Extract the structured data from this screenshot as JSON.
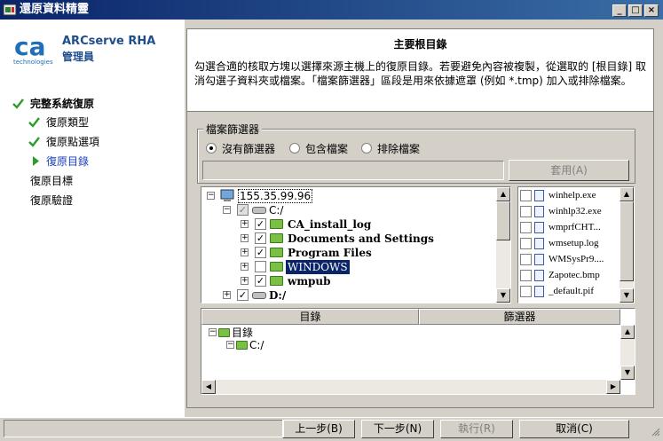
{
  "window": {
    "title": "還原資料精靈",
    "controls": [
      "_",
      "□",
      "×"
    ]
  },
  "brand": {
    "logo_text": "ca",
    "logo_sub": "technologies",
    "name": "ARCserve RHA",
    "subtitle": "管理員"
  },
  "nav": [
    {
      "label": "完整系統復原",
      "state": "done"
    },
    {
      "label": "復原類型",
      "state": "done"
    },
    {
      "label": "復原點選項",
      "state": "done"
    },
    {
      "label": "復原目錄",
      "state": "current"
    },
    {
      "label": "復原目標",
      "state": "todo"
    },
    {
      "label": "復原驗證",
      "state": "todo"
    }
  ],
  "header": {
    "title": "主要根目錄",
    "description": "勾選合適的核取方塊以選擇來源主機上的復原目錄。若要避免內容被複製，從選取的 [根目錄] 取消勾選子資料夾或檔案。「檔案篩選器」區段是用來依據遮罩 (例如 *.tmp) 加入或排除檔案。"
  },
  "filter": {
    "legend": "檔案篩選器",
    "options": [
      {
        "label": "沒有篩選器",
        "selected": true
      },
      {
        "label": "包含檔案",
        "selected": false
      },
      {
        "label": "排除檔案",
        "selected": false
      }
    ],
    "input_value": "",
    "apply_label": "套用(A)"
  },
  "tree": {
    "host": "155.35.99.96",
    "drive_c": "C:/",
    "folders": [
      {
        "label": "CA_install_log",
        "checked": true
      },
      {
        "label": "Documents and Settings",
        "checked": true
      },
      {
        "label": "Program Files",
        "checked": true
      },
      {
        "label": "WINDOWS",
        "checked": false,
        "selected": true
      },
      {
        "label": "wmpub",
        "checked": true
      }
    ],
    "drive_d": "D:/"
  },
  "files": [
    "winhelp.exe",
    "winhlp32.exe",
    "wmprfCHT...",
    "wmsetup.log",
    "WMSysPr9....",
    "Zapotec.bmp",
    "_default.pif"
  ],
  "dirtable": {
    "columns": [
      "目錄",
      "篩選器"
    ],
    "root": "目錄",
    "child": "C:/"
  },
  "buttons": {
    "back": "上一步(B)",
    "next": "下一步(N)",
    "run": "執行(R)",
    "cancel": "取消(C)"
  },
  "colors": {
    "title_bar": "#0a246a",
    "accent": "#1f4e8c",
    "done_check": "#2e9b2e",
    "current": "#1a3fbf"
  }
}
